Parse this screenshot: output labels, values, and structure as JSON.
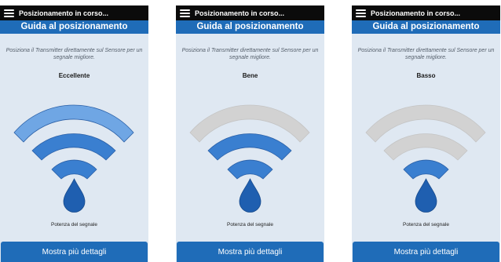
{
  "screens": [
    {
      "status_title": "Posizionamento in corso...",
      "header_title": "Guida al posizionamento",
      "instruction": "Posiziona il Transmitter direttamente sul Sensore per un segnale migliore.",
      "level_label": "Eccellente",
      "signal_bars": 3,
      "strength_label": "Potenza del segnale",
      "details_button": "Mostra più dettagli"
    },
    {
      "status_title": "Posizionamento in corso...",
      "header_title": "Guida al posizionamento",
      "instruction": "Posiziona il Transmitter direttamente sul Sensore per un segnale migliore.",
      "level_label": "Bene",
      "signal_bars": 2,
      "strength_label": "Potenza del segnale",
      "details_button": "Mostra più dettagli"
    },
    {
      "status_title": "Posizionamento in corso...",
      "header_title": "Guida al posizionamento",
      "instruction": "Posiziona il Transmitter direttamente sul Sensore per un segnale migliore.",
      "level_label": "Basso",
      "signal_bars": 1,
      "strength_label": "Potenza del segnale",
      "details_button": "Mostra più dettagli"
    }
  ],
  "colors": {
    "active_arc": "#3a7fd0",
    "active_arc_light": "#6fa6e4",
    "inactive_arc": "#d2d2d2",
    "drop": "#1f5fb0",
    "header": "#1f6cb8",
    "panel_background": "#dfe8f2"
  }
}
